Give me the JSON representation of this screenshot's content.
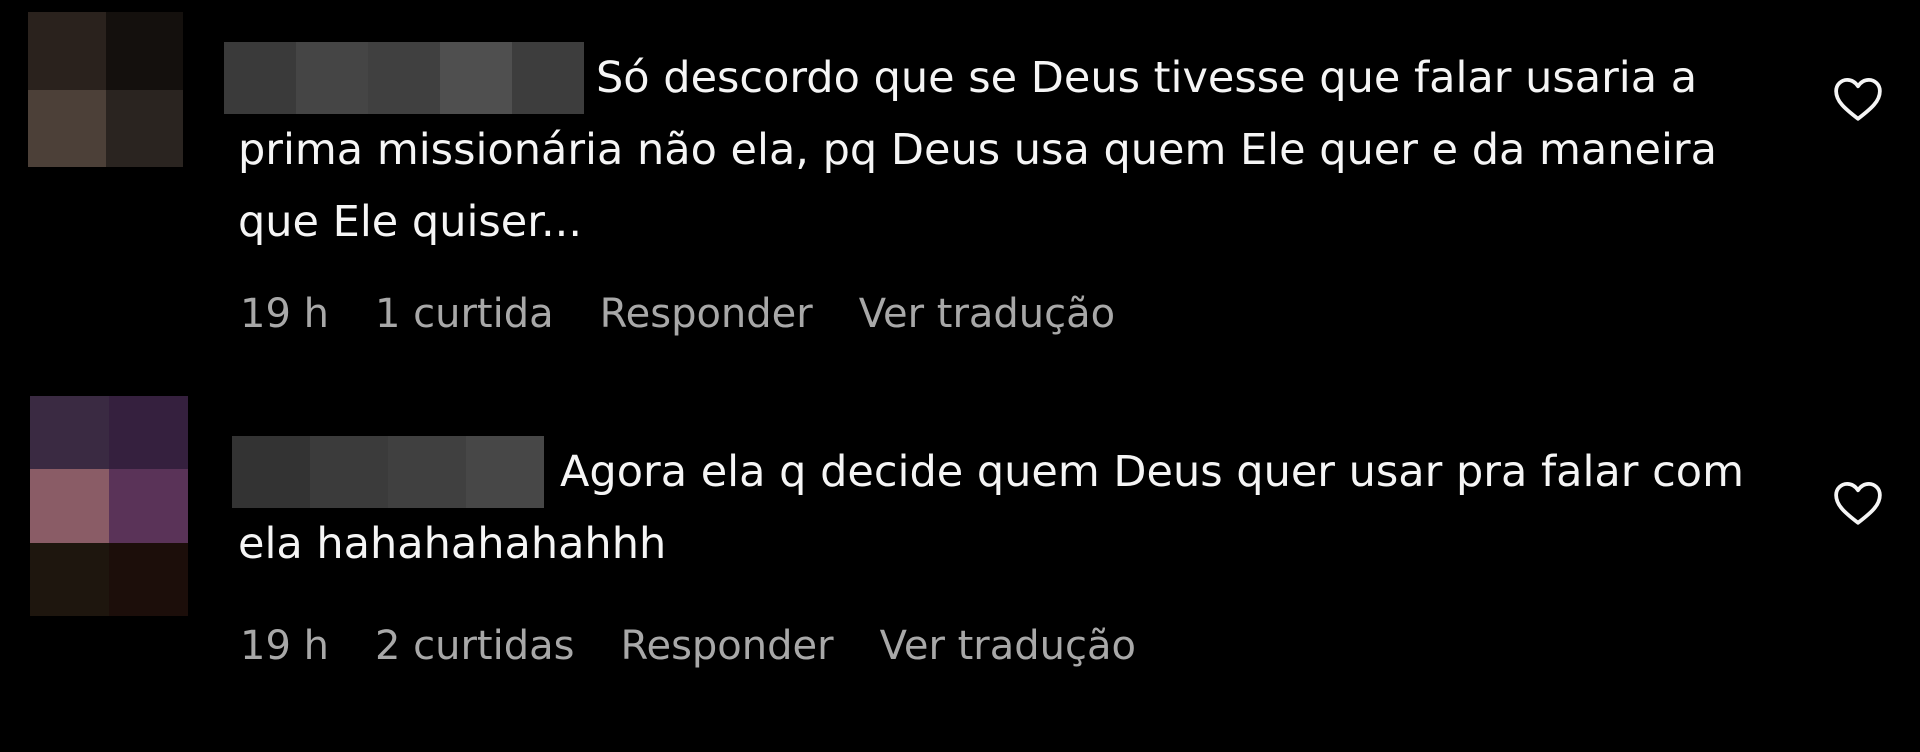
{
  "colors": {
    "background": "#000000",
    "comment_text": "#f5f5f5",
    "meta_text": "#a8a8a8",
    "heart_stroke": "#f5f5f5"
  },
  "comments": [
    {
      "username_note": "redacted by pixelation",
      "avatar_pixels": [
        "#2a221d",
        "#14100d",
        "#4c4038",
        "#2a2420"
      ],
      "username_pixels": [
        "#3a3a3a",
        "#454545",
        "#404040",
        "#4f4f4f",
        "#3d3d3d"
      ],
      "text": "Só descordo que se Deus tivesse que falar usaria a prima missionária não ela, pq Deus usa quem Ele quer e da maneira que Ele quiser...",
      "time": "19 h",
      "likes": "1 curtida",
      "reply_label": "Responder",
      "translate_label": "Ver tradução",
      "like_icon": "heart-outline-icon"
    },
    {
      "username_note": "redacted by pixelation",
      "avatar_pixels": [
        "#3a2a42",
        "#35203e",
        "#8a5c66",
        "#5a3358",
        "#1e160e",
        "#1c0e0a"
      ],
      "username_pixels": [
        "#333333",
        "#3b3b3b",
        "#404040",
        "#474747"
      ],
      "text": "Agora ela q decide quem Deus quer usar pra falar com ela hahahahahahhh",
      "time": "19 h",
      "likes": "2 curtidas",
      "reply_label": "Responder",
      "translate_label": "Ver tradução",
      "like_icon": "heart-outline-icon"
    }
  ]
}
